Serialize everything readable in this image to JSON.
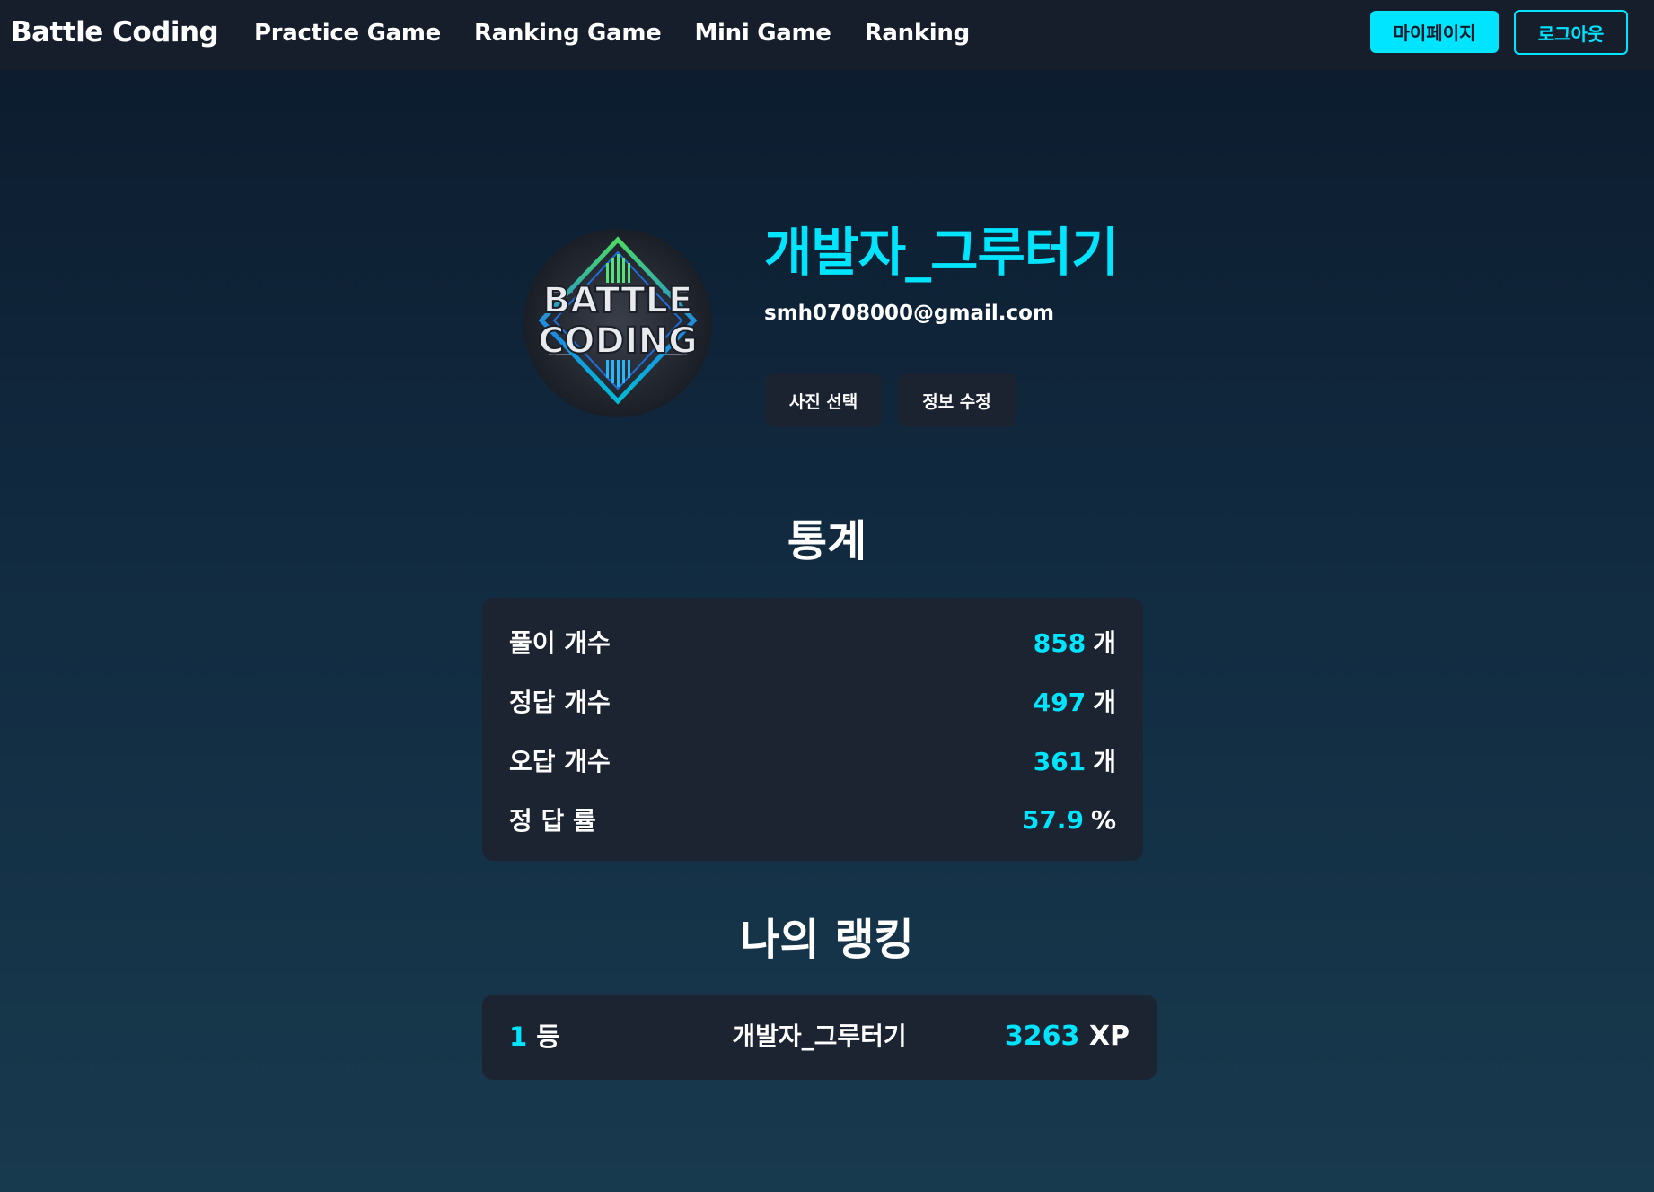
{
  "navbar": {
    "brand": "Battle Coding",
    "links": [
      "Practice Game",
      "Ranking Game",
      "Mini Game",
      "Ranking"
    ],
    "mypage_label": "마이페이지",
    "logout_label": "로그아웃"
  },
  "profile": {
    "avatar_lines": [
      "BATTLE",
      "CODING"
    ],
    "username": "개발자_그루터기",
    "email": "smh0708000@gmail.com",
    "photo_button": "사진 선택",
    "edit_button": "정보 수정"
  },
  "stats": {
    "title": "통계",
    "rows": [
      {
        "label": "풀이 개수",
        "value": "858",
        "unit": "개"
      },
      {
        "label": "정답 개수",
        "value": "497",
        "unit": "개"
      },
      {
        "label": "오답 개수",
        "value": "361",
        "unit": "개"
      },
      {
        "label": "정 답 률",
        "value": "57.9",
        "unit": "%"
      }
    ]
  },
  "ranking": {
    "title": "나의 랭킹",
    "rank": "1",
    "rank_unit": "등",
    "name": "개발자_그루터기",
    "xp": "3263",
    "xp_unit": "XP"
  },
  "colors": {
    "accent": "#00e5ff",
    "navbar_bg": "#161d2b",
    "card_bg": "#1c2331"
  }
}
